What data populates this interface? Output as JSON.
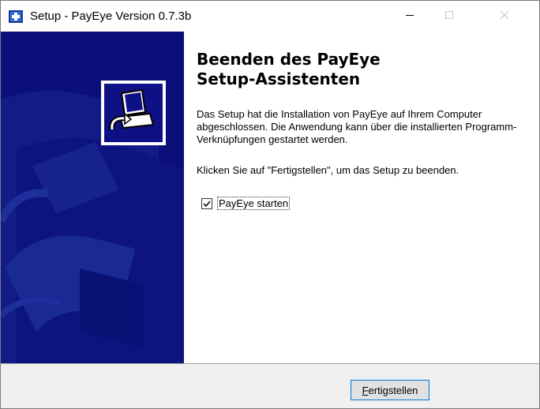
{
  "window": {
    "title": "Setup - PayEye Version 0.7.3b",
    "icons": {
      "app": "setup-icon",
      "minimize": "minimize-icon",
      "maximize": "maximize-icon",
      "close": "close-icon"
    }
  },
  "content": {
    "heading": "Beenden des PayEye\nSetup-Assistenten",
    "paragraph1": "Das Setup hat die Installation von PayEye auf Ihrem Computer abgeschlossen. Die Anwendung kann über die installierten Programm-Verknüpfungen gestartet werden.",
    "paragraph2": "Klicken Sie auf \"Fertigstellen\", um das Setup zu beenden.",
    "checkbox": {
      "label": "PayEye starten",
      "checked": true
    }
  },
  "footer": {
    "finish_button": {
      "label_accel": "F",
      "label_rest": "ertigstellen"
    }
  },
  "colors": {
    "sidebar": "#0b0f7a",
    "accent": "#0078d7",
    "footer": "#f0f0f0"
  }
}
